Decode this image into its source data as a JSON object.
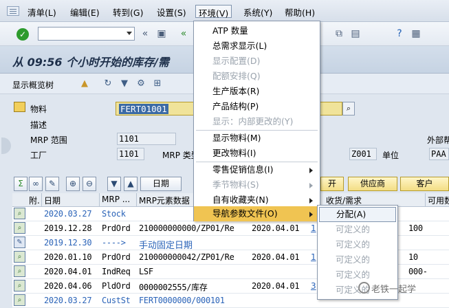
{
  "menubar": {
    "items": [
      "清单(L)",
      "编辑(E)",
      "转到(G)",
      "设置(S)",
      "环境(V)",
      "系统(Y)",
      "帮助(H)"
    ]
  },
  "window": {
    "title": "从 09:56 个小时开始的库存/需"
  },
  "app_toolbar": {
    "show_overview_tree": "显示概览树"
  },
  "form": {
    "material_label": "物料",
    "material_value": "FERT01001",
    "description_label": "描述",
    "mrp_area_label": "MRP 范围",
    "mrp_area_value": "1101",
    "plant_label": "工厂",
    "plant_value": "1101",
    "mrp_type_label": "MRP 类型",
    "unit_code": "Z001",
    "unit_label": "单位",
    "unit_value": "PAA",
    "external_label": "外部帮"
  },
  "table_toolbar": {
    "date_button": "日期",
    "open_button": "开",
    "supplier_button": "供应商",
    "customer_button": "客户"
  },
  "table": {
    "headers": [
      "附.",
      "日期",
      "MRP ...",
      "MRP元素数据",
      "",
      "收货/需求",
      "可用数"
    ],
    "rows": [
      {
        "date": "2020.03.27",
        "mrp": "Stock",
        "data": "",
        "resched": "",
        "exc": "",
        "qty": "",
        "blue": true
      },
      {
        "date": "2019.12.28",
        "mrp": "PrdOrd",
        "data": "210000000000/ZP01/Re",
        "resched": "2020.04.01",
        "exc": "1",
        "qty": "100",
        "blue": false
      },
      {
        "date": "2019.12.30",
        "mrp": "---->",
        "data": "手动固定日期",
        "resched": "",
        "exc": "",
        "qty": "",
        "blue": true
      },
      {
        "date": "2020.01.10",
        "mrp": "PrdOrd",
        "data": "210000000042/ZP01/Re",
        "resched": "2020.04.01",
        "exc": "1",
        "qty": "10",
        "blue": false
      },
      {
        "date": "2020.04.01",
        "mrp": "IndReq",
        "data": "LSF",
        "resched": "",
        "exc": "",
        "qty": "000-",
        "blue": false
      },
      {
        "date": "2020.04.06",
        "mrp": "PldOrd",
        "data": "0000002555/库存",
        "resched": "2020.04.01",
        "exc": "3",
        "qty": "",
        "blue": false
      },
      {
        "date": "2020.03.27",
        "mrp": "CustSt",
        "data": "FERT0000000/000101",
        "resched": "",
        "exc": "",
        "qty": "",
        "blue": true
      }
    ]
  },
  "env_menu": {
    "items": [
      {
        "label": "ATP 数量",
        "disabled": false
      },
      {
        "label": "总需求显示(L)",
        "disabled": false
      },
      {
        "label": "显示配置(D)",
        "disabled": true
      },
      {
        "label": "配额安排(Q)",
        "disabled": true
      },
      {
        "label": "生产版本(R)",
        "disabled": false
      },
      {
        "label": "产品结构(P)",
        "disabled": false
      },
      {
        "label": "显示：内部更改的(Y)",
        "disabled": true
      },
      {
        "label": "显示物料(M)",
        "disabled": false
      },
      {
        "label": "更改物料(I)",
        "disabled": false
      },
      {
        "label": "零售促销信息(I)",
        "disabled": false
      },
      {
        "label": "季节物料(S)",
        "disabled": true
      },
      {
        "label": "自有收藏夹(N)",
        "disabled": false
      },
      {
        "label": "导航参数文件(O)",
        "disabled": false
      }
    ]
  },
  "nav_submenu": {
    "items": [
      {
        "label": "分配(A)",
        "disabled": false
      },
      {
        "label": "可定义的",
        "disabled": true
      },
      {
        "label": "可定义的",
        "disabled": true
      },
      {
        "label": "可定义的",
        "disabled": true
      },
      {
        "label": "可定义的",
        "disabled": true
      },
      {
        "label": "可定义的",
        "disabled": true
      }
    ]
  },
  "watermark": "老铁一起学",
  "colors": {
    "highlight": "#f0c452",
    "link_blue": "#2a63b8",
    "material_field": "#f0e39a"
  }
}
